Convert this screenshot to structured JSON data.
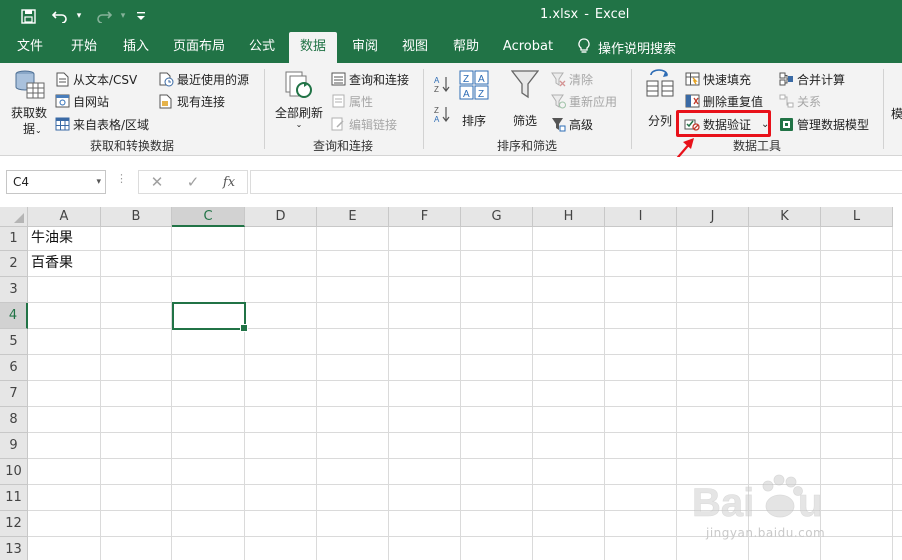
{
  "title_bar": {
    "file_name": "1.xlsx",
    "separator": "-",
    "app_name": "Excel",
    "qat_icons": [
      "save-icon",
      "undo-icon",
      "redo-icon",
      "customize-icon"
    ]
  },
  "tabs": [
    {
      "label": "文件",
      "active": false
    },
    {
      "label": "开始",
      "active": false
    },
    {
      "label": "插入",
      "active": false
    },
    {
      "label": "页面布局",
      "active": false
    },
    {
      "label": "公式",
      "active": false
    },
    {
      "label": "数据",
      "active": true
    },
    {
      "label": "审阅",
      "active": false
    },
    {
      "label": "视图",
      "active": false
    },
    {
      "label": "帮助",
      "active": false
    },
    {
      "label": "Acrobat",
      "active": false
    }
  ],
  "tell_me": {
    "label": "操作说明搜索",
    "icon": "lightbulb-icon"
  },
  "ribbon": {
    "get_data": {
      "label": "获取和转换数据",
      "big_button_line1": "获取数",
      "big_button_line2": "据",
      "from_text": "从文本/CSV",
      "from_web": "自网站",
      "from_table": "来自表格/区域",
      "recent_sources": "最近使用的源",
      "existing_connections": "现有连接"
    },
    "queries": {
      "label": "查询和连接",
      "refresh_all_line1": "全部刷新",
      "queries_connections": "查询和连接",
      "properties": "属性",
      "edit_links": "编辑链接"
    },
    "sort_filter": {
      "label": "排序和筛选",
      "sort": "排序",
      "filter": "筛选",
      "clear": "清除",
      "reapply": "重新应用",
      "advanced": "高级"
    },
    "data_tools": {
      "label": "数据工具",
      "text_to_columns": "分列",
      "flash_fill": "快速填充",
      "remove_duplicates": "删除重复值",
      "data_validation": "数据验证",
      "consolidate": "合并计算",
      "relationships": "关系",
      "manage_data_model": "管理数据模型"
    },
    "partial_next_group": "模"
  },
  "formula_bar": {
    "name_box": "C4",
    "cancel": "✕",
    "enter": "✓",
    "fx": "fx",
    "formula": ""
  },
  "grid": {
    "columns": [
      "A",
      "B",
      "C",
      "D",
      "E",
      "F",
      "G",
      "H",
      "I",
      "J",
      "K",
      "L"
    ],
    "rows": [
      "1",
      "2",
      "3",
      "4",
      "5",
      "6",
      "7",
      "8",
      "9",
      "10",
      "11",
      "12",
      "13"
    ],
    "selected_column": "C",
    "selected_row": "4",
    "cells": {
      "A1": "牛油果",
      "A2": "百香果"
    }
  },
  "watermark": {
    "brand": "Baidu经验",
    "url": "jingyan.baidu.com"
  },
  "colors": {
    "excel_green": "#217346",
    "ribbon_bg": "#f3f3f3",
    "highlight_red": "#e8111a"
  }
}
